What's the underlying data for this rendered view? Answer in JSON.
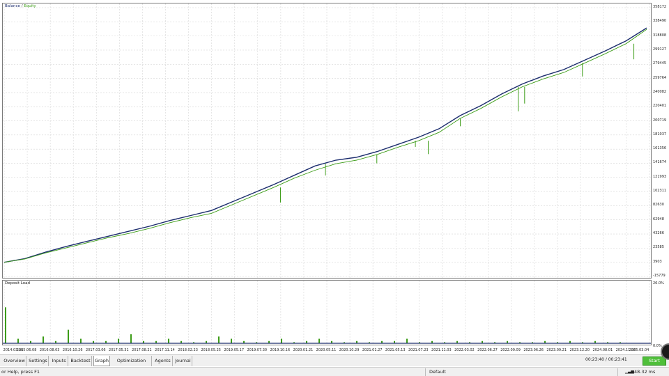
{
  "legend": {
    "balance": "Balance",
    "separator": "/",
    "equity": "Equity"
  },
  "deposit_load_title": "Deposit Load",
  "colors": {
    "balance": "#1c2d6e",
    "equity": "#3c9c17",
    "grid": "#cfcfcf",
    "start": "#4fbf3a"
  },
  "y_axis_labels": [
    "358172",
    "338490",
    "318808",
    "299127",
    "279445",
    "259764",
    "240082",
    "220401",
    "200719",
    "181037",
    "161356",
    "141674",
    "121993",
    "102311",
    "82630",
    "62948",
    "43266",
    "23585",
    "3903",
    "-15779"
  ],
  "deposit_axis_labels": [
    "26.0%",
    "0.0%"
  ],
  "x_axis_labels": [
    "2014.03.20",
    "2015.06.08",
    "2016.08.03",
    "2016.10.26",
    "2017.03.06",
    "2017.05.31",
    "2017.08.21",
    "2017.11.14",
    "2018.02.23",
    "2018.05.25",
    "2019.05.17",
    "2019.07.30",
    "2019.10.16",
    "2020.01.21",
    "2020.05.11",
    "2020.10.29",
    "2021.01.27",
    "2021.05.13",
    "2021.07.23",
    "2021.11.03",
    "2022.03.02",
    "2022.06.27",
    "2022.09.09",
    "2023.06.26",
    "2023.09.21",
    "2023.12.20",
    "2024.08.01",
    "2024.11.26",
    "2025.03.04"
  ],
  "tabs": [
    "Overview",
    "Settings",
    "Inputs",
    "Backtest",
    "Graph",
    "Optimization Results",
    "Agents",
    "Journal"
  ],
  "active_tab": "Graph",
  "timer": "00:23:40 / 00:23:41",
  "start_label": "Start",
  "status": {
    "help": "or Help, press F1",
    "profile": "Default",
    "ping": "48.32 ms"
  },
  "chart_data": [
    {
      "type": "line",
      "title": "",
      "series": [
        {
          "name": "Balance",
          "color": "#1c2d6e",
          "values": [
            3903,
            9000,
            18000,
            26000,
            33000,
            40000,
            47000,
            54000,
            62000,
            69000,
            76000,
            88000,
            100000,
            112000,
            125000,
            138000,
            146000,
            150000,
            158000,
            168000,
            178000,
            190000,
            208000,
            222000,
            238000,
            252000,
            263000,
            272000,
            285000,
            298000,
            312000,
            330000
          ]
        },
        {
          "name": "Equity",
          "color": "#3c9c17",
          "values": [
            3903,
            8500,
            17000,
            24000,
            31000,
            38000,
            44000,
            51000,
            59000,
            66000,
            72000,
            84000,
            96000,
            108000,
            121000,
            132000,
            141000,
            146000,
            154000,
            164000,
            173000,
            185000,
            204000,
            218000,
            234000,
            248000,
            259000,
            268000,
            281000,
            294000,
            308000,
            328000
          ]
        }
      ],
      "ylim": [
        -15779,
        358172
      ],
      "grid": true,
      "legend": "top-left"
    },
    {
      "type": "bar",
      "title": "Deposit Load",
      "ylim": [
        0,
        26
      ],
      "values": [
        16,
        2,
        1,
        3,
        1,
        6,
        2,
        1,
        1,
        2,
        4,
        1,
        1,
        2,
        1,
        0.5,
        1,
        3,
        2,
        1,
        0.5,
        1,
        2,
        0.5,
        1,
        2,
        1,
        0.5,
        1,
        0.5,
        1,
        1,
        2,
        0.5,
        1,
        0.5,
        1,
        0.5,
        1,
        0.5,
        1,
        0.5,
        0.5,
        1,
        0.5,
        1,
        0.5,
        1,
        0.5,
        0.5
      ]
    }
  ]
}
